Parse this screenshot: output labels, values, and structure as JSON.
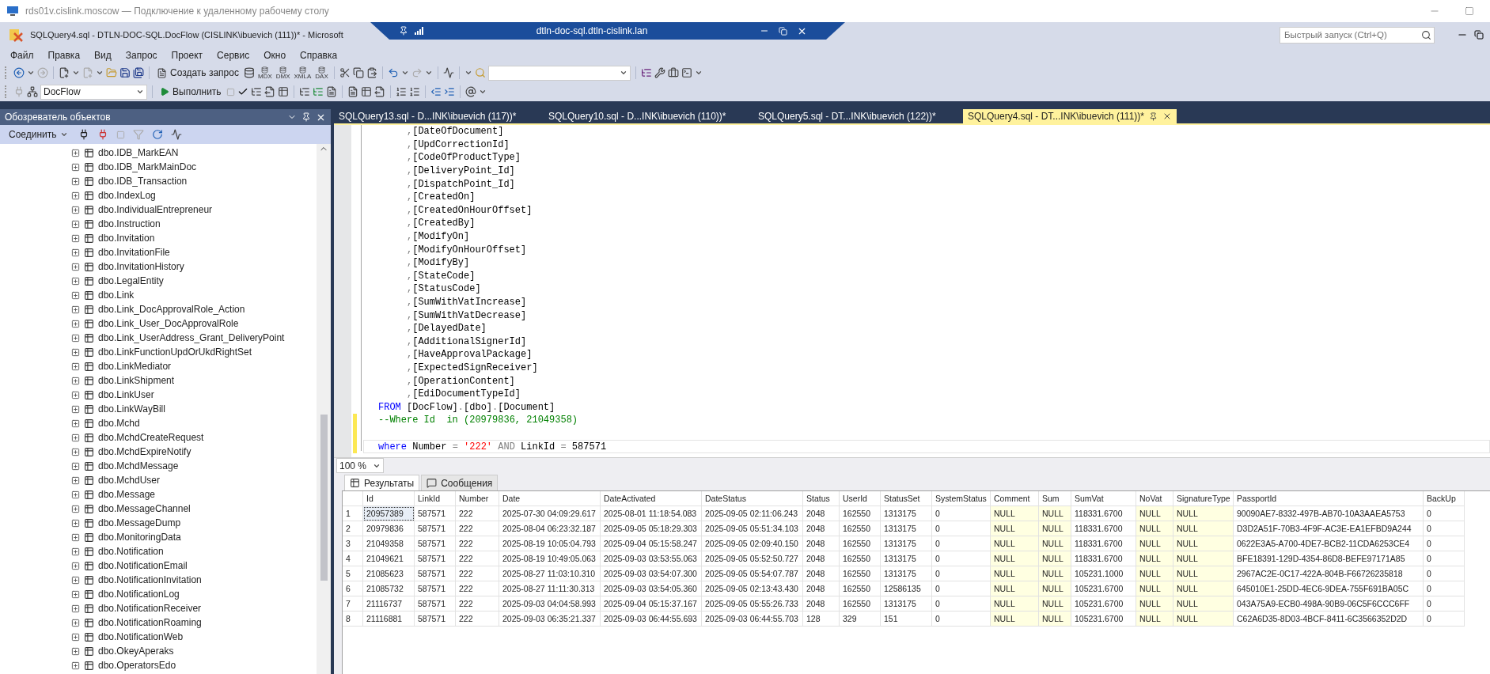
{
  "remote_session": {
    "title": "rds01v.cislink.moscow — Подключение к удаленному рабочему столу",
    "connection_bar": {
      "host": "dtln-doc-sql.dtln-cislink.lan"
    }
  },
  "window": {
    "title": "SQLQuery4.sql - DTLN-DOC-SQL.DocFlow (CISLINK\\ibuevich (111))* - Microsoft",
    "quick_launch": {
      "placeholder": "Быстрый запуск (Ctrl+Q)"
    }
  },
  "menu": [
    "Файл",
    "Правка",
    "Вид",
    "Запрос",
    "Проект",
    "Сервис",
    "Окно",
    "Справка"
  ],
  "toolbar": {
    "new_query": "Создать запрос",
    "query_types": [
      "MDX",
      "DMX",
      "XMLA",
      "DAX"
    ],
    "database": "DocFlow",
    "execute": "Выполнить"
  },
  "object_explorer": {
    "title": "Обозреватель объектов",
    "connect": "Соединить",
    "items": [
      {
        "label": "dbo.IDB_MarkEAN",
        "expanded": false
      },
      {
        "label": "dbo.IDB_MarkMainDoc",
        "expanded": false
      },
      {
        "label": "dbo.IDB_Transaction",
        "expanded": false
      },
      {
        "label": "dbo.IndexLog",
        "expanded": false
      },
      {
        "label": "dbo.IndividualEntrepreneur",
        "expanded": false
      },
      {
        "label": "dbo.Instruction",
        "expanded": false
      },
      {
        "label": "dbo.Invitation",
        "expanded": false
      },
      {
        "label": "dbo.InvitationFile",
        "expanded": false
      },
      {
        "label": "dbo.InvitationHistory",
        "expanded": false
      },
      {
        "label": "dbo.LegalEntity",
        "expanded": false
      },
      {
        "label": "dbo.Link",
        "expanded": false
      },
      {
        "label": "dbo.Link_DocApprovalRole_Action",
        "expanded": false
      },
      {
        "label": "dbo.Link_User_DocApprovalRole",
        "expanded": false
      },
      {
        "label": "dbo.Link_UserAddress_Grant_DeliveryPoint",
        "expanded": false
      },
      {
        "label": "dbo.LinkFunctionUpdOrUkdRightSet",
        "expanded": false
      },
      {
        "label": "dbo.LinkMediator",
        "expanded": false
      },
      {
        "label": "dbo.LinkShipment",
        "expanded": false
      },
      {
        "label": "dbo.LinkUser",
        "expanded": false
      },
      {
        "label": "dbo.LinkWayBill",
        "expanded": false
      },
      {
        "label": "dbo.Mchd",
        "expanded": false
      },
      {
        "label": "dbo.MchdCreateRequest",
        "expanded": false
      },
      {
        "label": "dbo.MchdExpireNotify",
        "expanded": false
      },
      {
        "label": "dbo.MchdMessage",
        "expanded": false
      },
      {
        "label": "dbo.MchdUser",
        "expanded": false
      },
      {
        "label": "dbo.Message",
        "expanded": false
      },
      {
        "label": "dbo.MessageChannel",
        "expanded": false
      },
      {
        "label": "dbo.MessageDump",
        "expanded": false
      },
      {
        "label": "dbo.MonitoringData",
        "expanded": false
      },
      {
        "label": "dbo.Notification",
        "expanded": false
      },
      {
        "label": "dbo.NotificationEmail",
        "expanded": false
      },
      {
        "label": "dbo.NotificationInvitation",
        "expanded": false
      },
      {
        "label": "dbo.NotificationLog",
        "expanded": false
      },
      {
        "label": "dbo.NotificationReceiver",
        "expanded": false
      },
      {
        "label": "dbo.NotificationRoaming",
        "expanded": false
      },
      {
        "label": "dbo.NotificationWeb",
        "expanded": false
      },
      {
        "label": "dbo.OkeyAperaks",
        "expanded": false
      },
      {
        "label": "dbo.OperatorsEdo",
        "expanded": false
      }
    ]
  },
  "editor": {
    "tabs": [
      {
        "label": "SQLQuery13.sql - D...INK\\ibuevich (117))*",
        "selected": false
      },
      {
        "label": "SQLQuery10.sql - D...INK\\ibuevich (110))*",
        "selected": false
      },
      {
        "label": "SQLQuery5.sql - DT...INK\\ibuevich (122))*",
        "selected": false
      },
      {
        "label": "SQLQuery4.sql - DT...INK\\ibuevich (111))*",
        "selected": true
      }
    ],
    "lines": [
      {
        "kind": "column",
        "modified": false,
        "current": false,
        "tokens": [
          {
            "kind": "punct",
            "text": ","
          },
          {
            "kind": "text",
            "text": "[DateOfDocument]"
          }
        ]
      },
      {
        "kind": "column",
        "modified": false,
        "current": false,
        "tokens": [
          {
            "kind": "punct",
            "text": ","
          },
          {
            "kind": "text",
            "text": "[UpdCorrectionId]"
          }
        ]
      },
      {
        "kind": "column",
        "modified": false,
        "current": false,
        "tokens": [
          {
            "kind": "punct",
            "text": ","
          },
          {
            "kind": "text",
            "text": "[CodeOfProductType]"
          }
        ]
      },
      {
        "kind": "column",
        "modified": false,
        "current": false,
        "tokens": [
          {
            "kind": "punct",
            "text": ","
          },
          {
            "kind": "text",
            "text": "[DeliveryPoint_Id]"
          }
        ]
      },
      {
        "kind": "column",
        "modified": false,
        "current": false,
        "tokens": [
          {
            "kind": "punct",
            "text": ","
          },
          {
            "kind": "text",
            "text": "[DispatchPoint_Id]"
          }
        ]
      },
      {
        "kind": "column",
        "modified": false,
        "current": false,
        "tokens": [
          {
            "kind": "punct",
            "text": ","
          },
          {
            "kind": "text",
            "text": "[CreatedOn]"
          }
        ]
      },
      {
        "kind": "column",
        "modified": false,
        "current": false,
        "tokens": [
          {
            "kind": "punct",
            "text": ","
          },
          {
            "kind": "text",
            "text": "[CreatedOnHourOffset]"
          }
        ]
      },
      {
        "kind": "column",
        "modified": false,
        "current": false,
        "tokens": [
          {
            "kind": "punct",
            "text": ","
          },
          {
            "kind": "text",
            "text": "[CreatedBy]"
          }
        ]
      },
      {
        "kind": "column",
        "modified": false,
        "current": false,
        "tokens": [
          {
            "kind": "punct",
            "text": ","
          },
          {
            "kind": "text",
            "text": "[ModifyOn]"
          }
        ]
      },
      {
        "kind": "column",
        "modified": false,
        "current": false,
        "tokens": [
          {
            "kind": "punct",
            "text": ","
          },
          {
            "kind": "text",
            "text": "[ModifyOnHourOffset]"
          }
        ]
      },
      {
        "kind": "column",
        "modified": false,
        "current": false,
        "tokens": [
          {
            "kind": "punct",
            "text": ","
          },
          {
            "kind": "text",
            "text": "[ModifyBy]"
          }
        ]
      },
      {
        "kind": "column",
        "modified": false,
        "current": false,
        "tokens": [
          {
            "kind": "punct",
            "text": ","
          },
          {
            "kind": "text",
            "text": "[StateCode]"
          }
        ]
      },
      {
        "kind": "column",
        "modified": false,
        "current": false,
        "tokens": [
          {
            "kind": "punct",
            "text": ","
          },
          {
            "kind": "text",
            "text": "[StatusCode]"
          }
        ]
      },
      {
        "kind": "column",
        "modified": false,
        "current": false,
        "tokens": [
          {
            "kind": "punct",
            "text": ","
          },
          {
            "kind": "text",
            "text": "[SumWithVatIncrease]"
          }
        ]
      },
      {
        "kind": "column",
        "modified": false,
        "current": false,
        "tokens": [
          {
            "kind": "punct",
            "text": ","
          },
          {
            "kind": "text",
            "text": "[SumWithVatDecrease]"
          }
        ]
      },
      {
        "kind": "column",
        "modified": false,
        "current": false,
        "tokens": [
          {
            "kind": "punct",
            "text": ","
          },
          {
            "kind": "text",
            "text": "[DelayedDate]"
          }
        ]
      },
      {
        "kind": "column",
        "modified": false,
        "current": false,
        "tokens": [
          {
            "kind": "punct",
            "text": ","
          },
          {
            "kind": "text",
            "text": "[AdditionalSignerId]"
          }
        ]
      },
      {
        "kind": "column",
        "modified": false,
        "current": false,
        "tokens": [
          {
            "kind": "punct",
            "text": ","
          },
          {
            "kind": "text",
            "text": "[HaveApprovalPackage]"
          }
        ]
      },
      {
        "kind": "column",
        "modified": false,
        "current": false,
        "tokens": [
          {
            "kind": "punct",
            "text": ","
          },
          {
            "kind": "text",
            "text": "[ExpectedSignReceiver]"
          }
        ]
      },
      {
        "kind": "column",
        "modified": false,
        "current": false,
        "tokens": [
          {
            "kind": "punct",
            "text": ","
          },
          {
            "kind": "text",
            "text": "[OperationContent]"
          }
        ]
      },
      {
        "kind": "column",
        "modified": false,
        "current": false,
        "tokens": [
          {
            "kind": "punct",
            "text": ","
          },
          {
            "kind": "text",
            "text": "[EdiDocumentTypeId]"
          }
        ]
      },
      {
        "kind": "clause",
        "modified": false,
        "current": false,
        "tokens": [
          {
            "kind": "keyword",
            "text": "FROM"
          },
          {
            "kind": "text",
            "text": " [DocFlow]"
          },
          {
            "kind": "punct",
            "text": "."
          },
          {
            "kind": "text",
            "text": "[dbo]"
          },
          {
            "kind": "punct",
            "text": "."
          },
          {
            "kind": "text",
            "text": "[Document]"
          }
        ]
      },
      {
        "kind": "clause",
        "modified": true,
        "current": false,
        "tokens": [
          {
            "kind": "comment",
            "text": "--Where Id  in (20979836, 21049358)"
          }
        ]
      },
      {
        "kind": "blank",
        "modified": true,
        "current": false
      },
      {
        "kind": "clause",
        "modified": true,
        "current": true,
        "tokens": [
          {
            "kind": "keyword",
            "text": "where"
          },
          {
            "kind": "text",
            "text": " Number "
          },
          {
            "kind": "punct",
            "text": "= "
          },
          {
            "kind": "string",
            "text": "'222'"
          },
          {
            "kind": "punct",
            "text": " AND"
          },
          {
            "kind": "text",
            "text": " LinkId "
          },
          {
            "kind": "punct",
            "text": "="
          },
          {
            "kind": "text",
            "text": " 587571"
          }
        ]
      }
    ]
  },
  "results": {
    "zoom": "100 %",
    "tabs": [
      {
        "label": "Результаты",
        "kind": "grid",
        "selected": true
      },
      {
        "label": "Сообщения",
        "kind": "messages",
        "selected": false
      }
    ],
    "columns": [
      {
        "label": "Id",
        "shaded": false
      },
      {
        "label": "LinkId",
        "shaded": false
      },
      {
        "label": "Number",
        "shaded": false
      },
      {
        "label": "Date",
        "shaded": false
      },
      {
        "label": "DateActivated",
        "shaded": false
      },
      {
        "label": "DateStatus",
        "shaded": false
      },
      {
        "label": "Status",
        "shaded": false
      },
      {
        "label": "UserId",
        "shaded": false
      },
      {
        "label": "StatusSet",
        "shaded": false
      },
      {
        "label": "SystemStatus",
        "shaded": false
      },
      {
        "label": "Comment",
        "shaded": true
      },
      {
        "label": "Sum",
        "shaded": true
      },
      {
        "label": "SumVat",
        "shaded": false
      },
      {
        "label": "NoVat",
        "shaded": true
      },
      {
        "label": "SignatureType",
        "shaded": true
      },
      {
        "label": "PassportId",
        "shaded": false
      },
      {
        "label": "BackUp",
        "shaded": false
      }
    ],
    "rows": [
      {
        "number": "1",
        "selected": true,
        "cells": [
          "20957389",
          "587571",
          "222",
          "2025-07-30 04:09:29.617",
          "2025-08-01 11:18:54.083",
          "2025-09-05 02:11:06.243",
          "2048",
          "162550",
          "1313175",
          "0",
          "NULL",
          "NULL",
          "118331.6700",
          "NULL",
          "NULL",
          "90090AE7-8332-497B-AB70-10A3AAEA5753",
          "0"
        ]
      },
      {
        "number": "2",
        "selected": false,
        "cells": [
          "20979836",
          "587571",
          "222",
          "2025-08-04 06:23:32.187",
          "2025-09-05 05:18:29.303",
          "2025-09-05 05:51:34.103",
          "2048",
          "162550",
          "1313175",
          "0",
          "NULL",
          "NULL",
          "118331.6700",
          "NULL",
          "NULL",
          "D3D2A51F-70B3-4F9F-AC3E-EA1EFBD9A244",
          "0"
        ]
      },
      {
        "number": "3",
        "selected": false,
        "cells": [
          "21049358",
          "587571",
          "222",
          "2025-08-19 10:05:04.793",
          "2025-09-04 05:15:58.247",
          "2025-09-05 02:09:40.150",
          "2048",
          "162550",
          "1313175",
          "0",
          "NULL",
          "NULL",
          "118331.6700",
          "NULL",
          "NULL",
          "0622E3A5-A700-4DE7-BCB2-11CDA6253CE4",
          "0"
        ]
      },
      {
        "number": "4",
        "selected": false,
        "cells": [
          "21049621",
          "587571",
          "222",
          "2025-08-19 10:49:05.063",
          "2025-09-03 03:53:55.063",
          "2025-09-05 05:52:50.727",
          "2048",
          "162550",
          "1313175",
          "0",
          "NULL",
          "NULL",
          "118331.6700",
          "NULL",
          "NULL",
          "BFE18391-129D-4354-86D8-BEFE97171A85",
          "0"
        ]
      },
      {
        "number": "5",
        "selected": false,
        "cells": [
          "21085623",
          "587571",
          "222",
          "2025-08-27 11:03:10.310",
          "2025-09-03 03:54:07.300",
          "2025-09-05 05:54:07.787",
          "2048",
          "162550",
          "1313175",
          "0",
          "NULL",
          "NULL",
          "105231.1000",
          "NULL",
          "NULL",
          "2967AC2E-0C17-422A-804B-F66726235818",
          "0"
        ]
      },
      {
        "number": "6",
        "selected": false,
        "cells": [
          "21085732",
          "587571",
          "222",
          "2025-08-27 11:11:30.313",
          "2025-09-03 03:54:05.360",
          "2025-09-05 02:13:43.430",
          "2048",
          "162550",
          "12586135",
          "0",
          "NULL",
          "NULL",
          "105231.6700",
          "NULL",
          "NULL",
          "645010E1-25DD-4EC6-9DEA-755F691BA05C",
          "0"
        ]
      },
      {
        "number": "7",
        "selected": false,
        "cells": [
          "21116737",
          "587571",
          "222",
          "2025-09-03 04:04:58.993",
          "2025-09-04 05:15:37.167",
          "2025-09-05 05:55:26.733",
          "2048",
          "162550",
          "1313175",
          "0",
          "NULL",
          "NULL",
          "105231.6700",
          "NULL",
          "NULL",
          "043A75A9-ECB0-498A-90B9-06C5F6CCC6FF",
          "0"
        ]
      },
      {
        "number": "8",
        "selected": false,
        "cells": [
          "21116881",
          "587571",
          "222",
          "2025-09-03 06:35:21.337",
          "2025-09-03 06:44:55.693",
          "2025-09-03 06:44:55.703",
          "128",
          "329",
          "151",
          "0",
          "NULL",
          "NULL",
          "105231.6700",
          "NULL",
          "NULL",
          "C62A6D35-8D03-4BCF-8411-6C3566352D2D",
          "0"
        ]
      }
    ]
  }
}
